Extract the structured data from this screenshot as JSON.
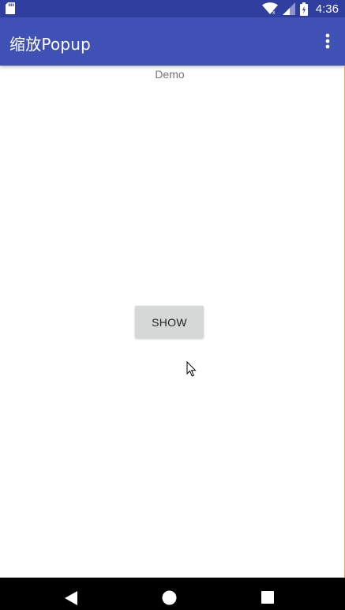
{
  "status_bar": {
    "time": "4:36",
    "icons": [
      "sd-card-icon",
      "wifi-icon",
      "signal-icon",
      "battery-icon"
    ]
  },
  "app_bar": {
    "title": "缩放Popup",
    "overflow_icon": "more-vert-icon"
  },
  "content": {
    "demo_label": "Demo",
    "show_button_label": "SHOW"
  },
  "nav_bar": {
    "icons": [
      "back-icon",
      "home-icon",
      "recents-icon"
    ]
  },
  "colors": {
    "status_bar": "#303f9f",
    "app_bar": "#3f51b5",
    "button_bg": "#d6d7d7",
    "nav_bar": "#000000"
  }
}
